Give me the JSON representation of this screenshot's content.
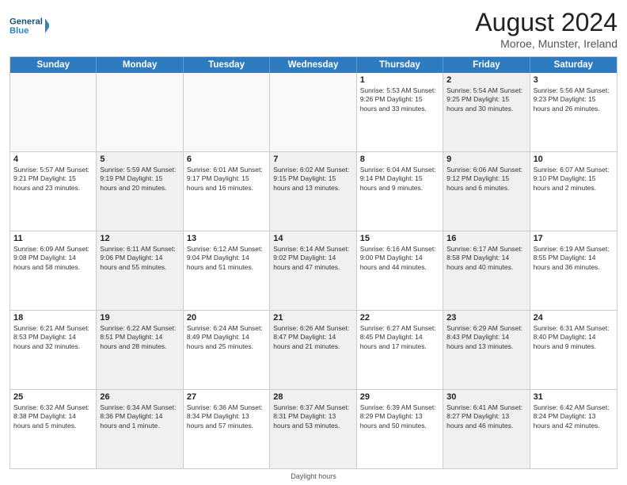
{
  "header": {
    "logo_line1": "General",
    "logo_line2": "Blue",
    "month_title": "August 2024",
    "location": "Moroe, Munster, Ireland"
  },
  "days_of_week": [
    "Sunday",
    "Monday",
    "Tuesday",
    "Wednesday",
    "Thursday",
    "Friday",
    "Saturday"
  ],
  "footer": "Daylight hours",
  "rows": [
    [
      {
        "day": "",
        "info": "",
        "shaded": false,
        "empty": true
      },
      {
        "day": "",
        "info": "",
        "shaded": false,
        "empty": true
      },
      {
        "day": "",
        "info": "",
        "shaded": false,
        "empty": true
      },
      {
        "day": "",
        "info": "",
        "shaded": false,
        "empty": true
      },
      {
        "day": "1",
        "info": "Sunrise: 5:53 AM\nSunset: 9:26 PM\nDaylight: 15 hours\nand 33 minutes.",
        "shaded": false
      },
      {
        "day": "2",
        "info": "Sunrise: 5:54 AM\nSunset: 9:25 PM\nDaylight: 15 hours\nand 30 minutes.",
        "shaded": true
      },
      {
        "day": "3",
        "info": "Sunrise: 5:56 AM\nSunset: 9:23 PM\nDaylight: 15 hours\nand 26 minutes.",
        "shaded": false
      }
    ],
    [
      {
        "day": "4",
        "info": "Sunrise: 5:57 AM\nSunset: 9:21 PM\nDaylight: 15 hours\nand 23 minutes.",
        "shaded": false
      },
      {
        "day": "5",
        "info": "Sunrise: 5:59 AM\nSunset: 9:19 PM\nDaylight: 15 hours\nand 20 minutes.",
        "shaded": true
      },
      {
        "day": "6",
        "info": "Sunrise: 6:01 AM\nSunset: 9:17 PM\nDaylight: 15 hours\nand 16 minutes.",
        "shaded": false
      },
      {
        "day": "7",
        "info": "Sunrise: 6:02 AM\nSunset: 9:15 PM\nDaylight: 15 hours\nand 13 minutes.",
        "shaded": true
      },
      {
        "day": "8",
        "info": "Sunrise: 6:04 AM\nSunset: 9:14 PM\nDaylight: 15 hours\nand 9 minutes.",
        "shaded": false
      },
      {
        "day": "9",
        "info": "Sunrise: 6:06 AM\nSunset: 9:12 PM\nDaylight: 15 hours\nand 6 minutes.",
        "shaded": true
      },
      {
        "day": "10",
        "info": "Sunrise: 6:07 AM\nSunset: 9:10 PM\nDaylight: 15 hours\nand 2 minutes.",
        "shaded": false
      }
    ],
    [
      {
        "day": "11",
        "info": "Sunrise: 6:09 AM\nSunset: 9:08 PM\nDaylight: 14 hours\nand 58 minutes.",
        "shaded": false
      },
      {
        "day": "12",
        "info": "Sunrise: 6:11 AM\nSunset: 9:06 PM\nDaylight: 14 hours\nand 55 minutes.",
        "shaded": true
      },
      {
        "day": "13",
        "info": "Sunrise: 6:12 AM\nSunset: 9:04 PM\nDaylight: 14 hours\nand 51 minutes.",
        "shaded": false
      },
      {
        "day": "14",
        "info": "Sunrise: 6:14 AM\nSunset: 9:02 PM\nDaylight: 14 hours\nand 47 minutes.",
        "shaded": true
      },
      {
        "day": "15",
        "info": "Sunrise: 6:16 AM\nSunset: 9:00 PM\nDaylight: 14 hours\nand 44 minutes.",
        "shaded": false
      },
      {
        "day": "16",
        "info": "Sunrise: 6:17 AM\nSunset: 8:58 PM\nDaylight: 14 hours\nand 40 minutes.",
        "shaded": true
      },
      {
        "day": "17",
        "info": "Sunrise: 6:19 AM\nSunset: 8:55 PM\nDaylight: 14 hours\nand 36 minutes.",
        "shaded": false
      }
    ],
    [
      {
        "day": "18",
        "info": "Sunrise: 6:21 AM\nSunset: 8:53 PM\nDaylight: 14 hours\nand 32 minutes.",
        "shaded": false
      },
      {
        "day": "19",
        "info": "Sunrise: 6:22 AM\nSunset: 8:51 PM\nDaylight: 14 hours\nand 28 minutes.",
        "shaded": true
      },
      {
        "day": "20",
        "info": "Sunrise: 6:24 AM\nSunset: 8:49 PM\nDaylight: 14 hours\nand 25 minutes.",
        "shaded": false
      },
      {
        "day": "21",
        "info": "Sunrise: 6:26 AM\nSunset: 8:47 PM\nDaylight: 14 hours\nand 21 minutes.",
        "shaded": true
      },
      {
        "day": "22",
        "info": "Sunrise: 6:27 AM\nSunset: 8:45 PM\nDaylight: 14 hours\nand 17 minutes.",
        "shaded": false
      },
      {
        "day": "23",
        "info": "Sunrise: 6:29 AM\nSunset: 8:43 PM\nDaylight: 14 hours\nand 13 minutes.",
        "shaded": true
      },
      {
        "day": "24",
        "info": "Sunrise: 6:31 AM\nSunset: 8:40 PM\nDaylight: 14 hours\nand 9 minutes.",
        "shaded": false
      }
    ],
    [
      {
        "day": "25",
        "info": "Sunrise: 6:32 AM\nSunset: 8:38 PM\nDaylight: 14 hours\nand 5 minutes.",
        "shaded": false
      },
      {
        "day": "26",
        "info": "Sunrise: 6:34 AM\nSunset: 8:36 PM\nDaylight: 14 hours\nand 1 minute.",
        "shaded": true
      },
      {
        "day": "27",
        "info": "Sunrise: 6:36 AM\nSunset: 8:34 PM\nDaylight: 13 hours\nand 57 minutes.",
        "shaded": false
      },
      {
        "day": "28",
        "info": "Sunrise: 6:37 AM\nSunset: 8:31 PM\nDaylight: 13 hours\nand 53 minutes.",
        "shaded": true
      },
      {
        "day": "29",
        "info": "Sunrise: 6:39 AM\nSunset: 8:29 PM\nDaylight: 13 hours\nand 50 minutes.",
        "shaded": false
      },
      {
        "day": "30",
        "info": "Sunrise: 6:41 AM\nSunset: 8:27 PM\nDaylight: 13 hours\nand 46 minutes.",
        "shaded": true
      },
      {
        "day": "31",
        "info": "Sunrise: 6:42 AM\nSunset: 8:24 PM\nDaylight: 13 hours\nand 42 minutes.",
        "shaded": false
      }
    ]
  ]
}
